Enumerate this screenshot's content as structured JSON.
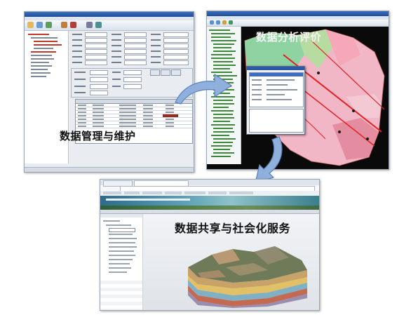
{
  "captions": {
    "data_management": "数据管理与维护",
    "data_analysis": "数据分析评价",
    "data_sharing": "数据共享与社会化服务"
  },
  "screens": [
    {
      "id": "management-window",
      "theme": "desktop-form-editor"
    },
    {
      "id": "analysis-window",
      "theme": "gis-map-viewer"
    },
    {
      "id": "sharing-window",
      "theme": "web-3d-geology-viewer"
    }
  ],
  "icons": [
    "curved-arrow-right",
    "curved-arrow-down"
  ],
  "colors": {
    "arrow_fill": "#8fb0dd",
    "arrow_stroke": "#5b7fb8",
    "map_background": "#0a0a0a",
    "map_red_lines": "#e02020",
    "titlebar": "#1f4e99",
    "web_banner": "#2c6b8a"
  }
}
